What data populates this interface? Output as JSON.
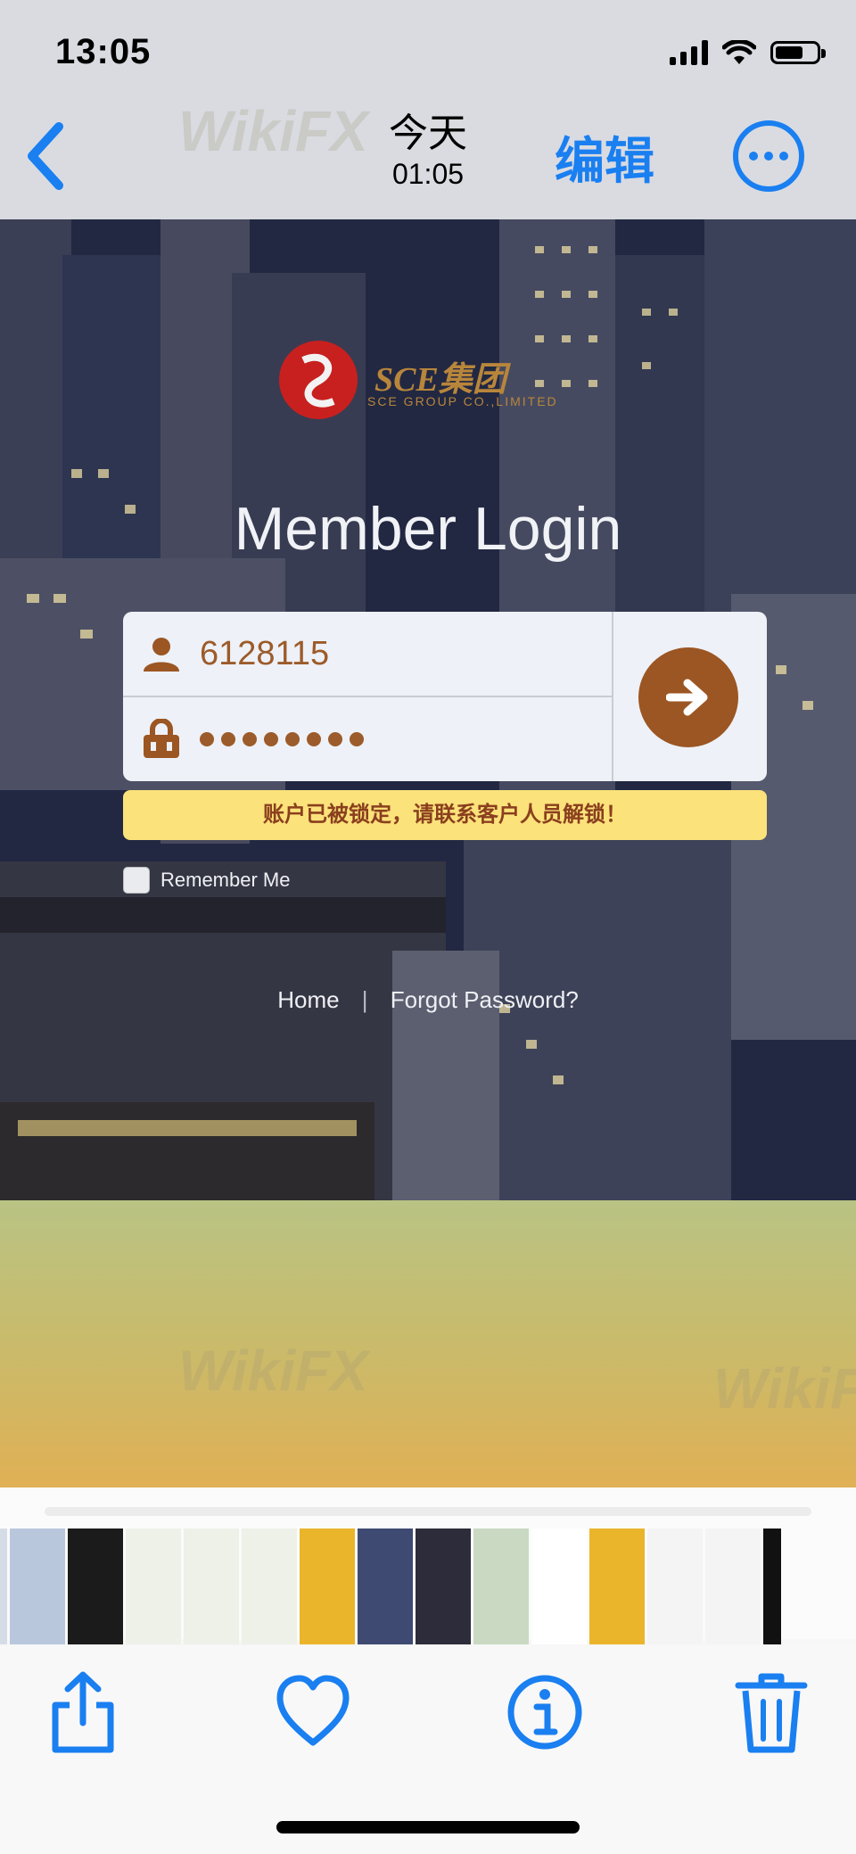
{
  "status_bar": {
    "time": "13:05"
  },
  "nav": {
    "date": "今天",
    "clock": "01:05",
    "edit_label": "编辑"
  },
  "login_page": {
    "logo_text": "SCE集团",
    "logo_sub": "SCE GROUP CO.,LIMITED",
    "title": "Member Login",
    "username_value": "6128115",
    "password_masked_length": 8,
    "warning": "账户已被锁定，请联系客户人员解锁！",
    "remember_label": "Remember Me",
    "home_link": "Home",
    "separator": "|",
    "forgot_link": "Forgot Password?"
  },
  "watermark_text": "WikiFX",
  "thumbnails": [
    {
      "color": "#d6dce6"
    },
    {
      "color": "#b9c7dc"
    },
    {
      "color": "#1b1b1b"
    },
    {
      "color": "#eef1e8"
    },
    {
      "color": "#eef1e8"
    },
    {
      "color": "#eef1e8"
    },
    {
      "color": "#eab52a"
    },
    {
      "color": "#3e4a72"
    },
    {
      "color": "#2c2c3a"
    },
    {
      "color": "#c9d9c2"
    },
    {
      "color": "#ffffff"
    },
    {
      "color": "#eab52a"
    },
    {
      "color": "#f4f4f4"
    },
    {
      "color": "#f4f4f4"
    },
    {
      "color": "#111111"
    }
  ],
  "colors": {
    "accent": "#1a7ff0",
    "brown": "#9b5623",
    "warning_bg": "#fbe27a"
  }
}
